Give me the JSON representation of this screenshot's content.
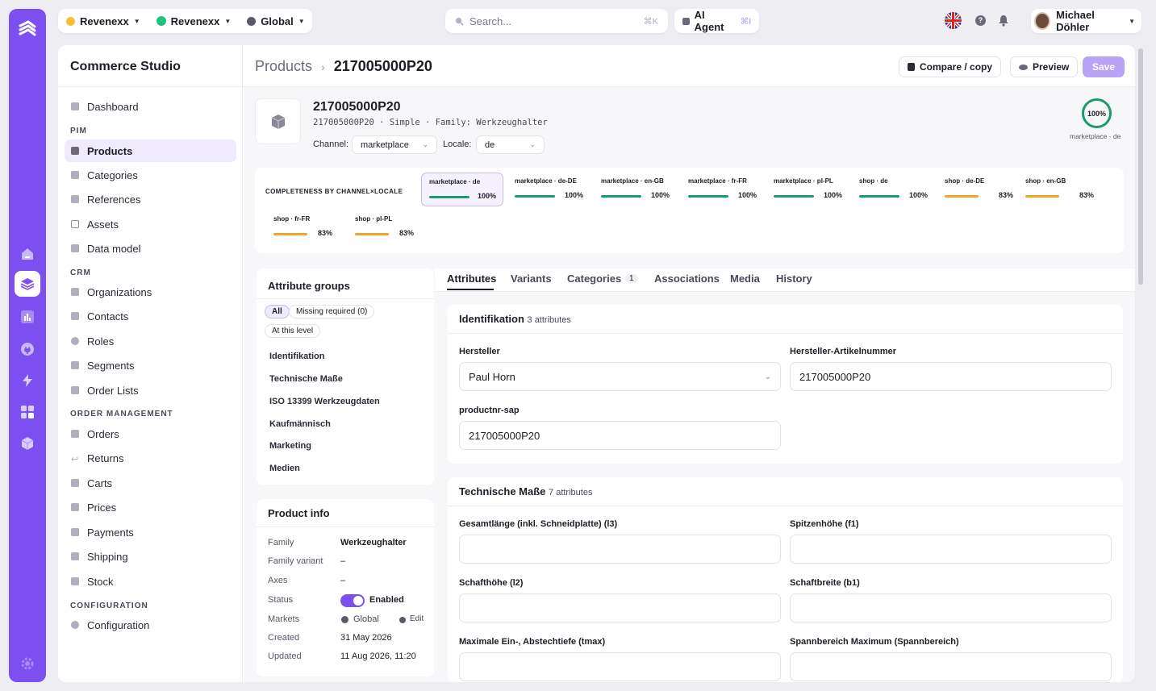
{
  "topbar": {
    "tenant_1": "Revenexx",
    "tenant_2": "Revenexx",
    "scope": "Global",
    "search_placeholder": "Search...",
    "search_shortcut": "⌘K",
    "ai_agent_label": "AI Agent",
    "ai_agent_shortcut": "⌘I",
    "user_name": "Michael Döhler"
  },
  "sidebar": {
    "title": "Commerce Studio",
    "sections": {
      "pim": "PIM",
      "crm": "CRM",
      "orders": "ORDER MANAGEMENT",
      "config": "CONFIGURATION"
    },
    "items": [
      "Dashboard",
      "Products",
      "Categories",
      "References",
      "Assets",
      "Data model",
      "Organizations",
      "Contacts",
      "Roles",
      "Segments",
      "Order Lists",
      "Orders",
      "Returns",
      "Carts",
      "Prices",
      "Payments",
      "Shipping",
      "Stock",
      "Configuration"
    ]
  },
  "header": {
    "breadcrumb_parent": "Products",
    "breadcrumb_sep": "›",
    "breadcrumb_current": "217005000P20",
    "compare_label": "Compare / copy",
    "preview_label": "Preview",
    "save_label": "Save"
  },
  "product": {
    "title": "217005000P20",
    "subtitle": "217005000P20 · Simple · Family: Werkzeughalter",
    "channel_label": "Channel:",
    "channel_value": "marketplace",
    "locale_label": "Locale:",
    "locale_value": "de",
    "completeness_value": "100%",
    "completeness_caption": "marketplace · de"
  },
  "completeness": {
    "heading": "COMPLETENESS BY CHANNEL×LOCALE",
    "items": [
      {
        "label": "marketplace · de",
        "value": "100%",
        "fraction": 1.0
      },
      {
        "label": "marketplace · de-DE",
        "value": "100%",
        "fraction": 1.0
      },
      {
        "label": "marketplace · en-GB",
        "value": "100%",
        "fraction": 1.0
      },
      {
        "label": "marketplace · fr-FR",
        "value": "100%",
        "fraction": 1.0
      },
      {
        "label": "marketplace · pl-PL",
        "value": "100%",
        "fraction": 1.0
      },
      {
        "label": "shop · de",
        "value": "100%",
        "fraction": 1.0
      },
      {
        "label": "shop · de-DE",
        "value": "83%",
        "fraction": 0.83
      },
      {
        "label": "shop · en-GB",
        "value": "83%",
        "fraction": 0.83
      },
      {
        "label": "shop · fr-FR",
        "value": "83%",
        "fraction": 0.83
      },
      {
        "label": "shop · pl-PL",
        "value": "83%",
        "fraction": 0.83
      }
    ],
    "colors": {
      "complete": "#1a9c6a",
      "partial": "#f0a428"
    }
  },
  "attribute_groups": {
    "title": "Attribute groups",
    "filter_all": "All",
    "filter_missing": "Missing required (0)",
    "filter_level": "At this level",
    "groups": [
      "Identifikation",
      "Technische Maße",
      "ISO 13399 Werkzeugdaten",
      "Kaufmännisch",
      "Marketing",
      "Medien"
    ]
  },
  "product_info": {
    "title": "Product info",
    "labels": [
      "Family",
      "Family variant",
      "Axes",
      "Status",
      "Markets",
      "Created",
      "Updated"
    ],
    "family": "Werkzeughalter",
    "family_variant": "–",
    "axes": "–",
    "status": "Enabled",
    "status_enabled": true,
    "markets": "Global",
    "markets_edit": "Edit",
    "created": "31 May 2026",
    "updated": "11 Aug 2026, 11:20"
  },
  "tabs": {
    "attributes": "Attributes",
    "variants": "Variants",
    "categories": "Categories",
    "categories_count": "1",
    "associations": "Associations",
    "media": "Media",
    "history": "History"
  },
  "identifikation": {
    "title": "Identifikation",
    "count": "3 attributes",
    "hersteller_label": "Hersteller",
    "hersteller_value": "Paul Horn",
    "artnr_label": "Hersteller-Artikelnummer",
    "artnr_value": "217005000P20",
    "sap_label": "productnr-sap",
    "sap_value": "217005000P20"
  },
  "technische": {
    "title": "Technische Maße",
    "count": "7 attributes",
    "fields": [
      "Gesamtlänge (inkl. Schneidplatte) (l3)",
      "Spitzenhöhe (f1)",
      "Schafthöhe (l2)",
      "Schaftbreite (b1)",
      "Maximale Ein-, Abstechtiefe (tmax)",
      "Spannbereich Maximum (Spannbereich)"
    ]
  },
  "theme": {
    "accent": "#7b4ff0",
    "success": "#1a9c6a",
    "warning": "#f0a428"
  }
}
